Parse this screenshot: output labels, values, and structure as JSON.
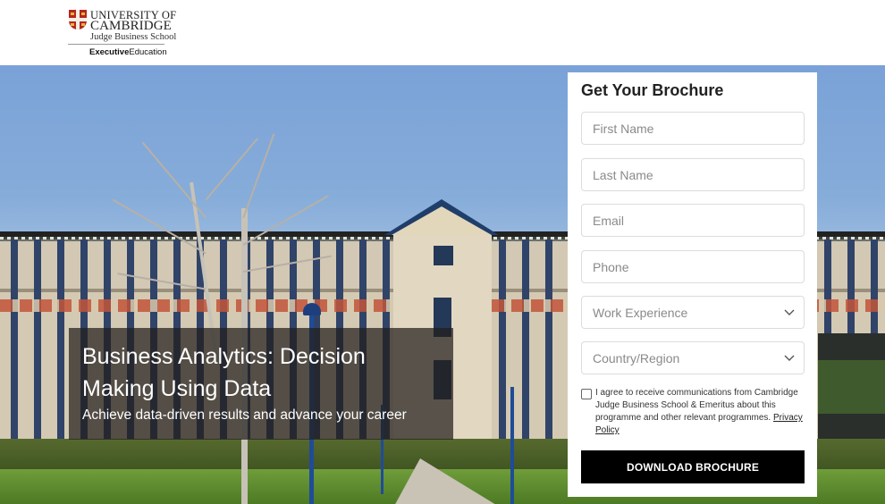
{
  "header": {
    "logo": {
      "line1": "UNIVERSITY OF",
      "line2": "CAMBRIDGE",
      "line3": "Judge Business School",
      "line4_bold": "Executive",
      "line4_regular": "Education",
      "crest_colors": {
        "field": "#b5261e",
        "cross": "#f2efe6",
        "accent": "#e7b53b"
      }
    }
  },
  "hero": {
    "title": "Business Analytics: Decision Making Using Data",
    "subtitle": "Achieve data-driven results and advance your career"
  },
  "form": {
    "title": "Get Your Brochure",
    "fields": {
      "first_name": {
        "placeholder": "First Name",
        "value": ""
      },
      "last_name": {
        "placeholder": "Last Name",
        "value": ""
      },
      "email": {
        "placeholder": "Email",
        "value": ""
      },
      "phone": {
        "placeholder": "Phone",
        "value": ""
      }
    },
    "selects": {
      "work_experience": {
        "selected": "Work Experience"
      },
      "country_region": {
        "selected": "Country/Region"
      }
    },
    "consent": {
      "checked": false,
      "text": "I agree to receive communications from Cambridge Judge Business School & Emeritus about this programme and other relevant programmes.",
      "link_label": "Privacy Policy"
    },
    "submit_label": "DOWNLOAD BROCHURE",
    "colors": {
      "button_bg": "#000000",
      "button_text": "#ffffff"
    }
  }
}
